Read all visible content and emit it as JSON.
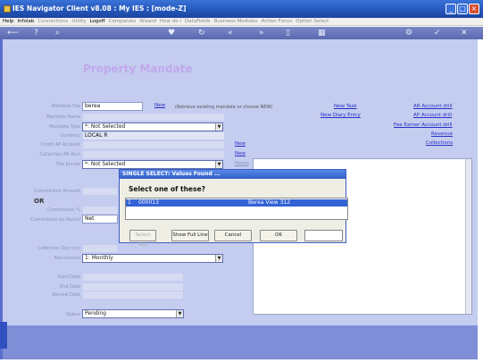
{
  "window": {
    "title": "IES Navigator Client v8.08 : My IES :     [mode-Z]"
  },
  "menu": [
    {
      "label": "Help",
      "enabled": true
    },
    {
      "label": "Infolab",
      "enabled": true
    },
    {
      "label": "Connections",
      "enabled": false
    },
    {
      "label": "Utility",
      "enabled": false
    },
    {
      "label": "Logoff",
      "enabled": true
    },
    {
      "label": "Companies",
      "enabled": false
    },
    {
      "label": "Wizard",
      "enabled": false
    },
    {
      "label": "How do I",
      "enabled": false
    },
    {
      "label": "DataFields",
      "enabled": false
    },
    {
      "label": "Business Modules",
      "enabled": false
    },
    {
      "label": "Action Focus",
      "enabled": false
    },
    {
      "label": "Option Select",
      "enabled": false
    }
  ],
  "page_title": "Property Mandate",
  "form": {
    "mandate_fee_label": "Mandate Fee",
    "mandate_fee_value": "berea",
    "new_label": "New",
    "retrieve_hint": "(Retrieve existing mandate or choose NEW)",
    "mandate_name_label": "Mandate Name",
    "mandate_type_label": "Mandate Type",
    "mandate_type_value": "*: Not Selected",
    "currency_label": "Currency",
    "currency_value": "LOCAL R",
    "credit_ap_label": "Credit AP Account",
    "collection_ar_label": "Collection AR Acct",
    "fee_earner_label": "Fee Earner",
    "fee_earner_value": "*: Not Selected",
    "commission_label": "Commission Amount",
    "or_label": "OR",
    "commission_pct_label": "Commission %",
    "commission_on_label": "Commission on Rental",
    "commission_on_value": "Net",
    "collection_day_label": "Collection Day (no)",
    "fee_interval_label": "Fee interval",
    "fee_interval_value": "1: Monthly",
    "start_date_label": "Start Date",
    "end_date_label": "End Date",
    "review_date_label": "Review Date",
    "status_label": "Status",
    "status_value": "Pending",
    "new_links": [
      "New",
      "New",
      "Notes"
    ]
  },
  "right_links": {
    "new_task": "New Task",
    "new_diary": "New Diary Entry",
    "ar_drill": "AR Account drill",
    "ap_drill": "AP Account drill",
    "fee_drill": "Fee Earner Account drill",
    "revenue": "Revenue",
    "collections": "Collections"
  },
  "dialog": {
    "title": "SINGLE SELECT: Values Found ...",
    "prompt": "Select one of these?",
    "row_index": "1",
    "row_code": "000013",
    "row_text": "Berea View 312",
    "btn_select_all": "Select ALL",
    "btn_show_full": "Show Full Line",
    "btn_cancel": "Cancel",
    "btn_ok": "OK"
  }
}
